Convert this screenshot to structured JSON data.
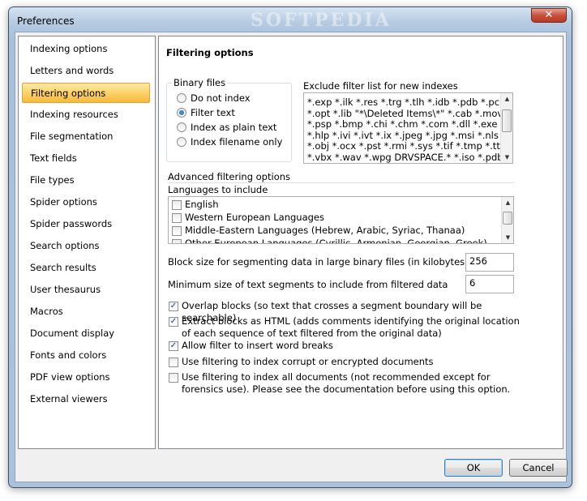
{
  "window": {
    "title": "Preferences",
    "watermark": "SOFTPEDIA",
    "close_glyph": "✕"
  },
  "sidebar": {
    "items": [
      {
        "label": "Indexing options"
      },
      {
        "label": "Letters and words"
      },
      {
        "label": "Filtering options",
        "active": true
      },
      {
        "label": "Indexing resources"
      },
      {
        "label": "File segmentation"
      },
      {
        "label": "Text fields"
      },
      {
        "label": "File types"
      },
      {
        "label": "Spider options"
      },
      {
        "label": "Spider passwords"
      },
      {
        "label": "Search options"
      },
      {
        "label": "Search results"
      },
      {
        "label": "User thesaurus"
      },
      {
        "label": "Macros"
      },
      {
        "label": "Document display"
      },
      {
        "label": "Fonts and colors"
      },
      {
        "label": "PDF view options"
      },
      {
        "label": "External viewers"
      }
    ]
  },
  "panel": {
    "title": "Filtering options",
    "binary_files": {
      "label": "Binary files",
      "options": [
        {
          "label": "Do not index",
          "checked": false
        },
        {
          "label": "Filter text",
          "checked": true
        },
        {
          "label": "Index as plain text",
          "checked": false
        },
        {
          "label": "Index filename only",
          "checked": false
        }
      ]
    },
    "exclude_filter": {
      "label": "Exclude filter list for new indexes",
      "lines": [
        "*.exp *.ilk *.res *.trg *.tlh *.idb *.pdb *.pch",
        "*.opt *.lib \"*\\Deleted Items\\*\" *.cab *.mov",
        "*.psp *.bmp *.chi *.chm *.com *.dll *.exe *.gif",
        "*.hlp *.ivi *.ivt *.ix *.jpeg *.jpg *.msi *.nls",
        "*.obj *.ocx *.pst *.rmi *.sys *.tif *.tmp *.ttf",
        "*.vbx *.wav *.wpg DRVSPACE.* *.iso *.pdb"
      ]
    },
    "advanced_label": "Advanced filtering options",
    "languages_label": "Languages to include",
    "languages": [
      {
        "label": "English",
        "checked": false
      },
      {
        "label": "Western European Languages",
        "checked": false
      },
      {
        "label": "Middle-Eastern Languages (Hebrew, Arabic, Syriac, Thanaa)",
        "checked": false
      },
      {
        "label": "Other European Languages (Cyrillic, Armenian, Georgian, Greek)",
        "checked": false
      }
    ],
    "block_size": {
      "label": "Block size for segmenting data in large binary files (in kilobytes)",
      "value": "256"
    },
    "min_size": {
      "label": "Minimum size of text segments to include from filtered data",
      "value": "6"
    },
    "checks": [
      {
        "label": "Overlap blocks (so text that crosses a segment boundary will be searchable)",
        "checked": true
      },
      {
        "label": "Extract blocks as HTML (adds comments identifying the original location of each sequence of text filtered from the original data)",
        "checked": true
      },
      {
        "label": "Allow filter to insert word breaks",
        "checked": true
      },
      {
        "label": "Use filtering to index corrupt or encrypted documents",
        "checked": false
      },
      {
        "label": "Use filtering to index all documents (not recommended except for forensics use).  Please see the documentation before using this option.",
        "checked": false
      }
    ]
  },
  "buttons": {
    "ok": "OK",
    "cancel": "Cancel"
  }
}
